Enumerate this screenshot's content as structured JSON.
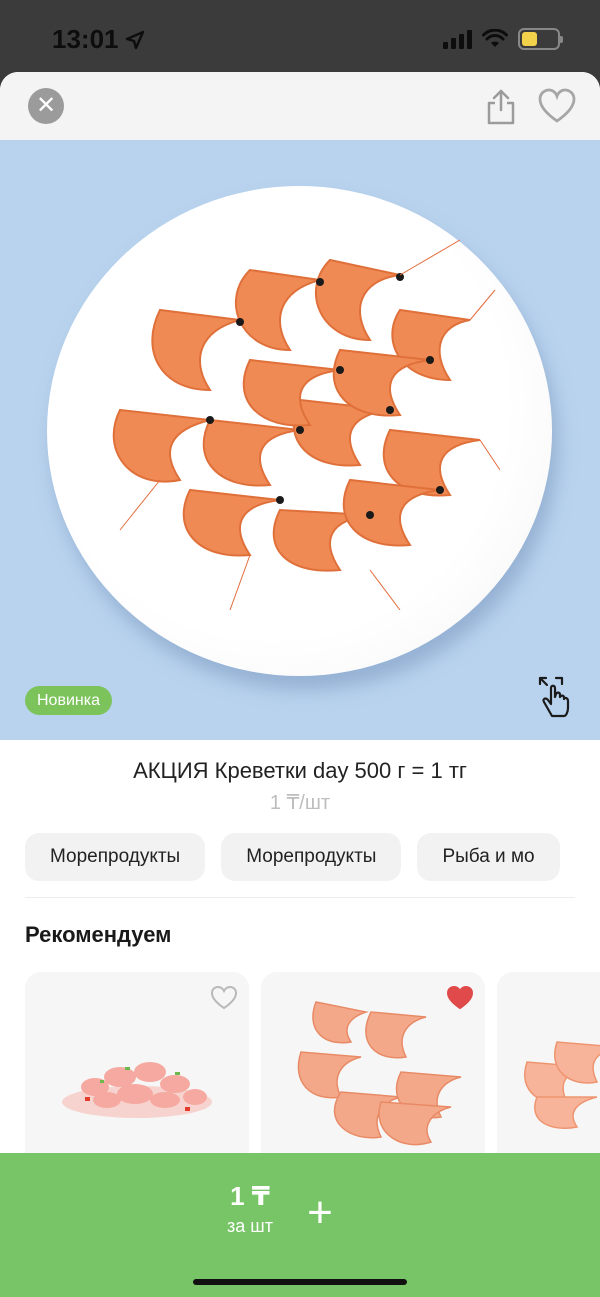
{
  "status": {
    "time": "13:01"
  },
  "product": {
    "badge": "Новинка",
    "title": "АКЦИЯ Креветки day 500 г = 1 тг",
    "price_unit": "1 ₸/шт"
  },
  "categories": [
    "Морепродукты",
    "Морепродукты",
    "Рыба и мо"
  ],
  "recommend": {
    "title": "Рекомендуем",
    "items": [
      {
        "favorite": false
      },
      {
        "favorite": true
      },
      {
        "favorite": false
      }
    ]
  },
  "bottom": {
    "price": "1 ₸",
    "unit": "за шт"
  },
  "colors": {
    "accent_green": "#77c566",
    "badge_green": "#7cc35c",
    "hero_bg": "#b9d3ee",
    "heart_active": "#e04a4a"
  },
  "icons": {
    "close": "close-icon",
    "share": "share-icon",
    "favorite": "heart-icon",
    "gesture": "tap-gesture-icon",
    "add": "plus-icon"
  }
}
